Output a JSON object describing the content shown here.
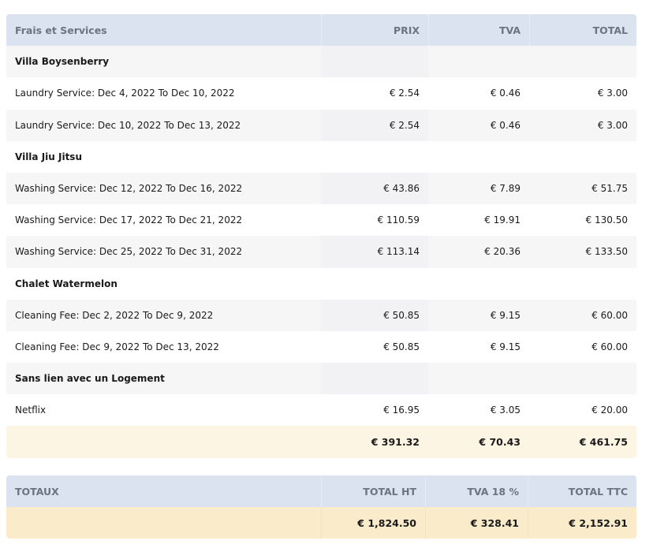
{
  "header": {
    "label": "Frais et Services",
    "prix": "PRIX",
    "tva": "TVA",
    "total": "TOTAL"
  },
  "rows": [
    {
      "type": "group",
      "label": "Villa Boysenberry",
      "prix": "",
      "tva": "",
      "total": ""
    },
    {
      "type": "item",
      "label": "Laundry Service: Dec 4, 2022 To Dec 10, 2022",
      "prix": "€ 2.54",
      "tva": "€ 0.46",
      "total": "€ 3.00"
    },
    {
      "type": "item",
      "label": "Laundry Service: Dec 10, 2022 To Dec 13, 2022",
      "prix": "€ 2.54",
      "tva": "€ 0.46",
      "total": "€ 3.00"
    },
    {
      "type": "group",
      "label": "Villa Jiu Jitsu",
      "prix": "",
      "tva": "",
      "total": ""
    },
    {
      "type": "item",
      "label": "Washing Service: Dec 12, 2022 To Dec 16, 2022",
      "prix": "€ 43.86",
      "tva": "€ 7.89",
      "total": "€ 51.75"
    },
    {
      "type": "item",
      "label": "Washing Service: Dec 17, 2022 To Dec 21, 2022",
      "prix": "€ 110.59",
      "tva": "€ 19.91",
      "total": "€ 130.50"
    },
    {
      "type": "item",
      "label": "Washing Service: Dec 25, 2022 To Dec 31, 2022",
      "prix": "€ 113.14",
      "tva": "€ 20.36",
      "total": "€ 133.50"
    },
    {
      "type": "group",
      "label": "Chalet Watermelon",
      "prix": "",
      "tva": "",
      "total": ""
    },
    {
      "type": "item",
      "label": "Cleaning Fee: Dec 2, 2022 To Dec 9, 2022",
      "prix": "€ 50.85",
      "tva": "€ 9.15",
      "total": "€ 60.00"
    },
    {
      "type": "item",
      "label": "Cleaning Fee: Dec 9, 2022 To Dec 13, 2022",
      "prix": "€ 50.85",
      "tva": "€ 9.15",
      "total": "€ 60.00"
    },
    {
      "type": "group",
      "label": "Sans lien avec un Logement",
      "prix": "",
      "tva": "",
      "total": ""
    },
    {
      "type": "item",
      "label": "Netflix",
      "prix": "€ 16.95",
      "tva": "€ 3.05",
      "total": "€ 20.00"
    }
  ],
  "subtotal": {
    "prix": "€ 391.32",
    "tva": "€ 70.43",
    "total": "€ 461.75"
  },
  "totals": {
    "header": {
      "label": "TOTAUX",
      "ht": "TOTAL HT",
      "tva": "TVA 18 %",
      "ttc": "TOTAL TTC"
    },
    "values": {
      "ht": "€ 1,824.50",
      "tva": "€ 328.41",
      "ttc": "€ 2,152.91"
    }
  },
  "colors": {
    "header_bg": "#dbe2f0",
    "subtotal_bg": "#fdf5e4",
    "totals_bg": "#faecca"
  }
}
